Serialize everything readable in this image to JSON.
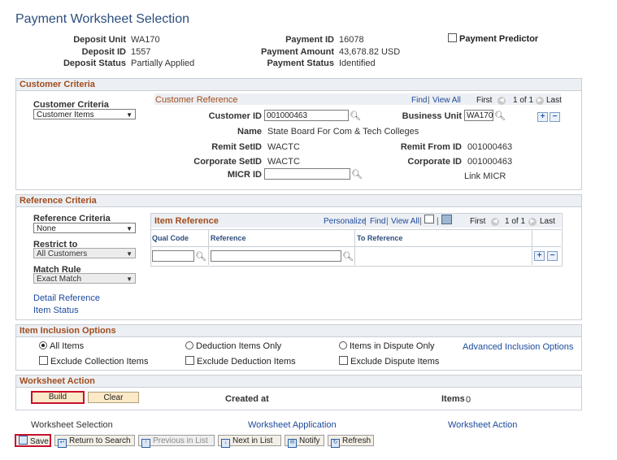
{
  "title": "Payment Worksheet Selection",
  "header": {
    "deposit_unit_label": "Deposit Unit",
    "deposit_unit": "WA170",
    "deposit_id_label": "Deposit ID",
    "deposit_id": "1557",
    "deposit_status_label": "Deposit Status",
    "deposit_status": "Partially Applied",
    "payment_id_label": "Payment ID",
    "payment_id": "16078",
    "payment_amount_label": "Payment Amount",
    "payment_amount": "43,678.82 USD",
    "payment_status_label": "Payment Status",
    "payment_status": "Identified",
    "payment_predictor_label": "Payment Predictor"
  },
  "customer_criteria": {
    "section_title": "Customer Criteria",
    "criteria_label": "Customer Criteria",
    "criteria_value": "Customer Items",
    "grid_title": "Customer Reference",
    "find": "Find",
    "view_all": "View All",
    "first": "First",
    "count": "1 of 1",
    "last": "Last",
    "customer_id_label": "Customer ID",
    "customer_id": "001000463",
    "business_unit_label": "Business Unit",
    "business_unit": "WA170",
    "name_label": "Name",
    "name": "State Board For Com & Tech Colleges",
    "remit_setid_label": "Remit SetID",
    "remit_setid": "WACTC",
    "remit_from_id_label": "Remit From ID",
    "remit_from_id": "001000463",
    "corporate_setid_label": "Corporate SetID",
    "corporate_setid": "WACTC",
    "corporate_id_label": "Corporate ID",
    "corporate_id": "001000463",
    "micr_id_label": "MICR ID",
    "micr_id": "",
    "link_micr": "Link MICR"
  },
  "reference_criteria": {
    "section_title": "Reference Criteria",
    "criteria_label": "Reference Criteria",
    "criteria_value": "None",
    "restrict_label": "Restrict to",
    "restrict_value": "All Customers",
    "match_rule_label": "Match Rule",
    "match_rule_value": "Exact Match",
    "detail_reference": "Detail Reference",
    "item_status": "Item Status",
    "grid_title": "Item Reference",
    "personalize": "Personalize",
    "find": "Find",
    "view_all": "View All",
    "first": "First",
    "count": "1 of 1",
    "last": "Last",
    "columns": [
      "Qual Code",
      "Reference",
      "To Reference"
    ],
    "qual_code": "",
    "reference": ""
  },
  "item_inclusion": {
    "section_title": "Item Inclusion Options",
    "all_items": "All Items",
    "deduction_items_only": "Deduction Items Only",
    "items_in_dispute_only": "Items in Dispute Only",
    "advanced_inclusion": "Advanced Inclusion Options",
    "exclude_collection": "Exclude Collection Items",
    "exclude_deduction": "Exclude Deduction Items",
    "exclude_dispute": "Exclude Dispute Items"
  },
  "worksheet_action": {
    "section_title": "Worksheet Action",
    "build": "Build",
    "clear": "Clear",
    "created_at_label": "Created at",
    "items_label": "Items",
    "items_value": "0"
  },
  "footer_links": {
    "worksheet_selection": "Worksheet Selection",
    "worksheet_application": "Worksheet Application",
    "worksheet_action": "Worksheet Action"
  },
  "toolbar": {
    "save": "Save",
    "return_to_search": "Return to Search",
    "previous_in_list": "Previous in List",
    "next_in_list": "Next in List",
    "notify": "Notify",
    "refresh": "Refresh"
  }
}
